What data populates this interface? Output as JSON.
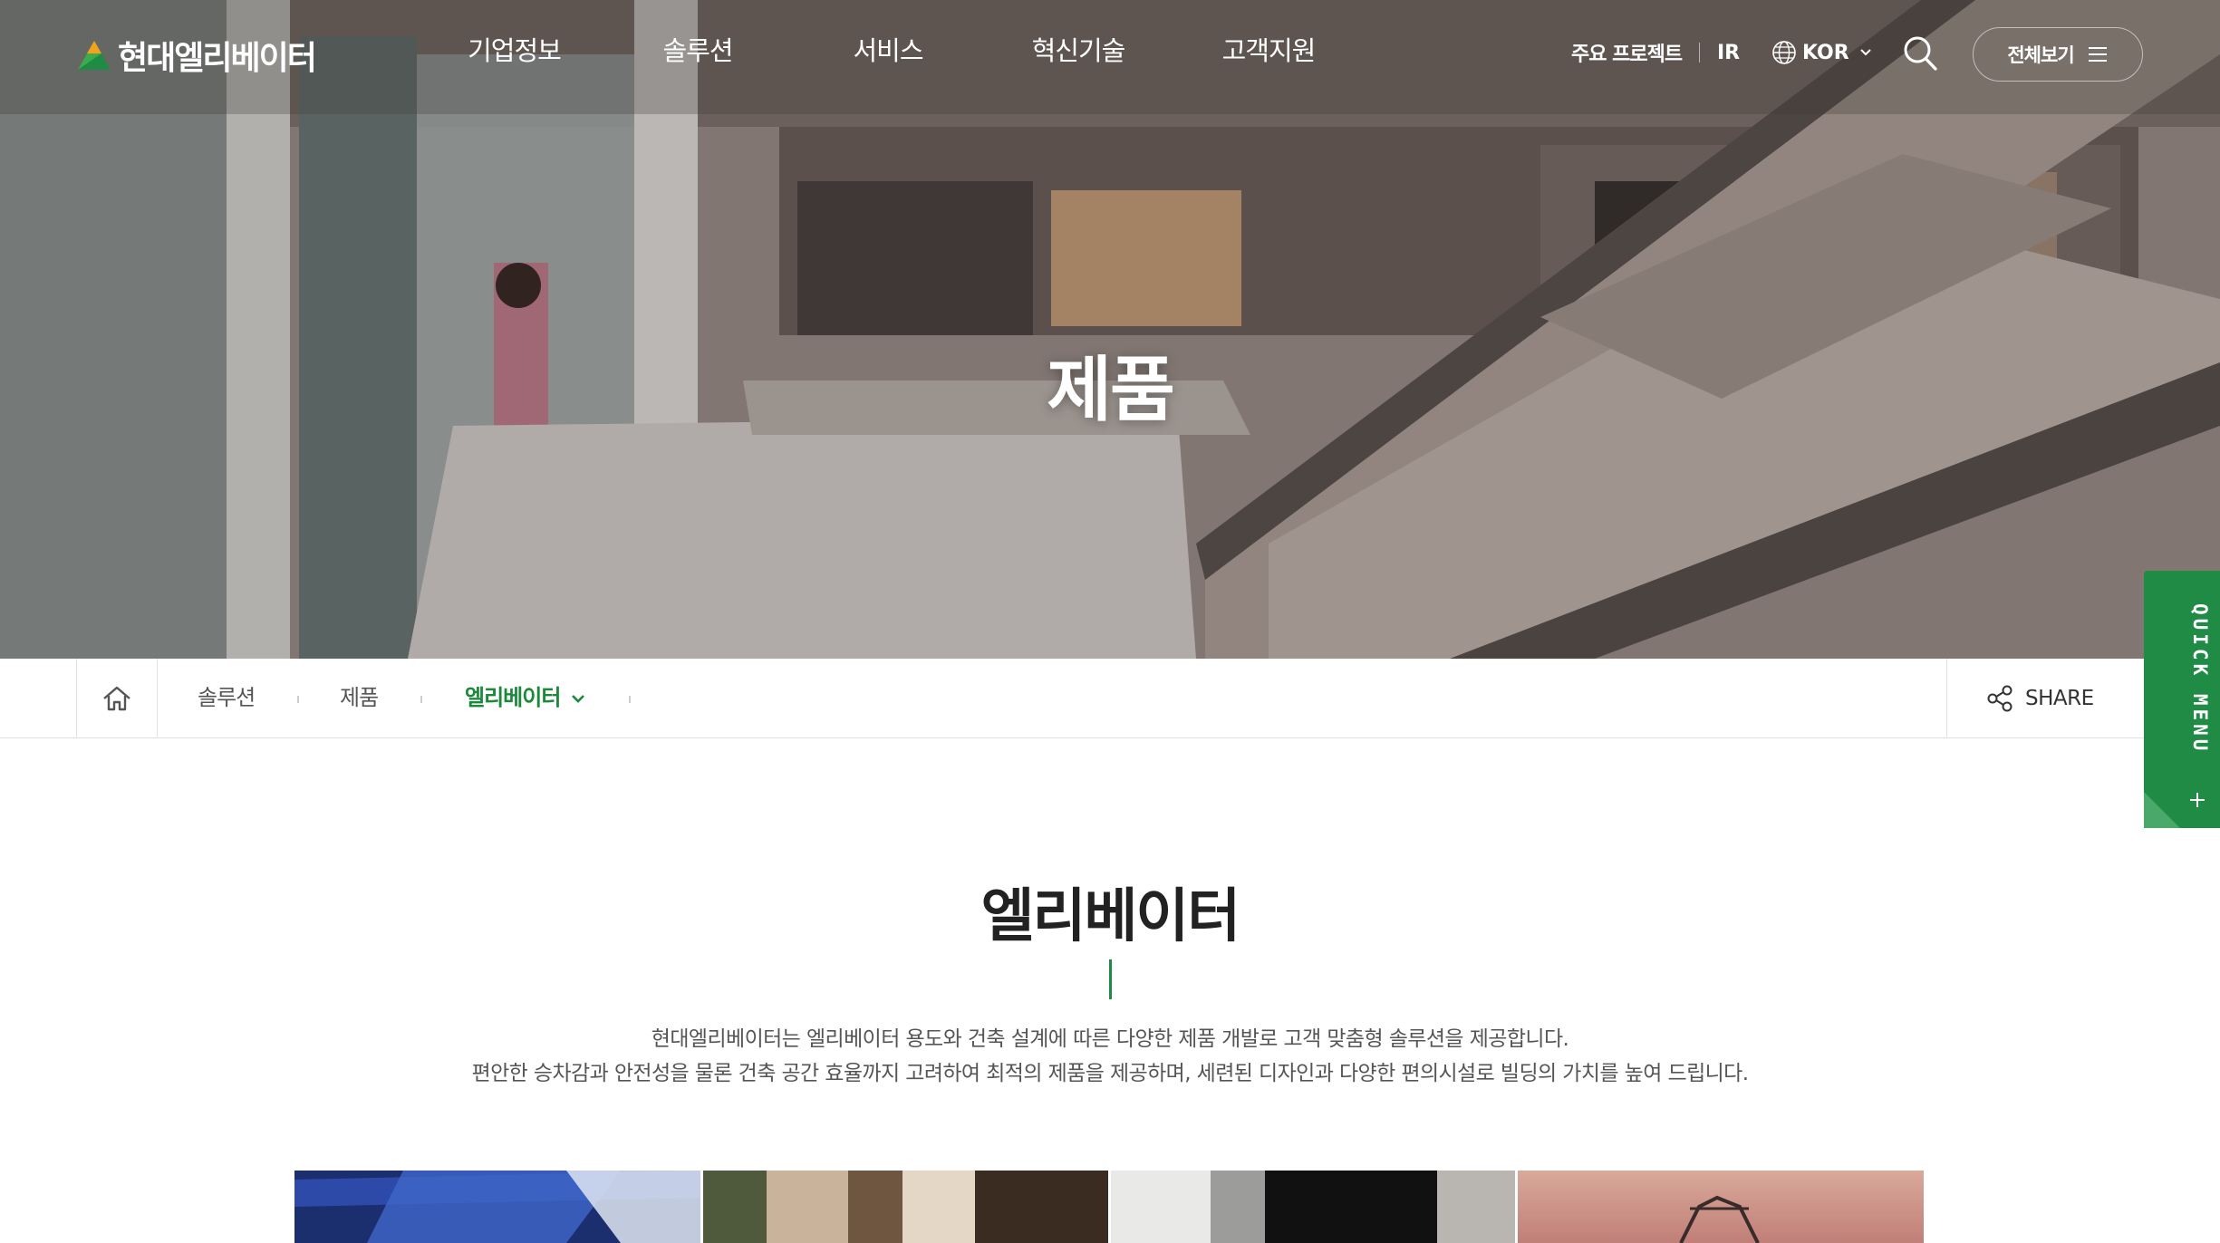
{
  "header": {
    "logo_text": "현대엘리베이터",
    "nav": [
      "기업정보",
      "솔루션",
      "서비스",
      "혁신기술",
      "고객지원"
    ],
    "projects_label": "주요 프로젝트",
    "ir_label": "IR",
    "language": "KOR",
    "allmenu_label": "전체보기"
  },
  "hero": {
    "title": "제품"
  },
  "breadcrumb": {
    "items": [
      "솔루션",
      "제품",
      "엘리베이터"
    ],
    "share_label": "SHARE"
  },
  "quick_menu": {
    "label": "QUICK MENU"
  },
  "content": {
    "title": "엘리베이터",
    "desc_line1": "현대엘리베이터는 엘리베이터 용도와 건축 설계에 따른 다양한 제품 개발로 고객 맞춤형 솔루션을 제공합니다.",
    "desc_line2": "편안한 승차감과 안전성을 물론 건축 공간 효율까지 고려하여 최적의 제품을 제공하며, 세련된 디자인과 다양한 편의시설로 빌딩의 가치를 높여 드립니다."
  },
  "colors": {
    "accent": "#1f8b45",
    "breadcrumb_active": "#1a8a3a"
  },
  "icons": [
    "logo-mark-icon",
    "globe-icon",
    "chevron-down-icon",
    "search-icon",
    "hamburger-icon",
    "home-icon",
    "share-icon",
    "plus-icon"
  ]
}
